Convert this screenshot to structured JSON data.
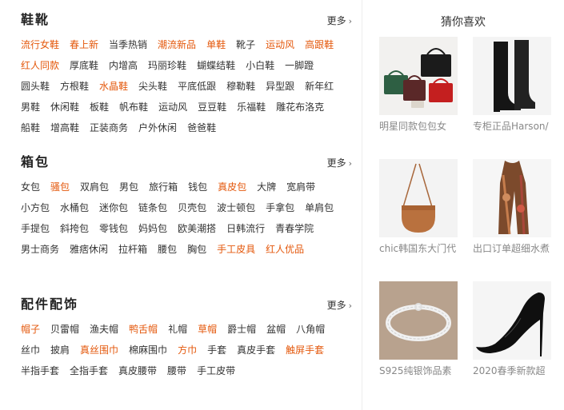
{
  "sections": [
    {
      "title": "鞋靴",
      "more": "更多",
      "tags": [
        {
          "t": "流行女鞋",
          "hot": true
        },
        {
          "t": "春上新",
          "hot": true
        },
        {
          "t": "当季热销",
          "hot": false
        },
        {
          "t": "潮流新品",
          "hot": true
        },
        {
          "t": "单鞋",
          "hot": true
        },
        {
          "t": "靴子",
          "hot": false
        },
        {
          "t": "运动风",
          "hot": true
        },
        {
          "t": "高跟鞋",
          "hot": true
        },
        {
          "t": "红人同款",
          "hot": true
        },
        {
          "t": "厚底鞋",
          "hot": false
        },
        {
          "t": "内增高",
          "hot": false
        },
        {
          "t": "玛丽珍鞋",
          "hot": false
        },
        {
          "t": "蝴蝶结鞋",
          "hot": false
        },
        {
          "t": "小白鞋",
          "hot": false
        },
        {
          "t": "一脚蹬",
          "hot": false
        },
        {
          "t": "圆头鞋",
          "hot": false
        },
        {
          "t": "方根鞋",
          "hot": false
        },
        {
          "t": "水晶鞋",
          "hot": true
        },
        {
          "t": "尖头鞋",
          "hot": false
        },
        {
          "t": "平底低跟",
          "hot": false
        },
        {
          "t": "穆勒鞋",
          "hot": false
        },
        {
          "t": "异型跟",
          "hot": false
        },
        {
          "t": "新年红",
          "hot": false
        },
        {
          "t": "男鞋",
          "hot": false
        },
        {
          "t": "休闲鞋",
          "hot": false
        },
        {
          "t": "板鞋",
          "hot": false
        },
        {
          "t": "帆布鞋",
          "hot": false
        },
        {
          "t": "运动风",
          "hot": false
        },
        {
          "t": "豆豆鞋",
          "hot": false
        },
        {
          "t": "乐福鞋",
          "hot": false
        },
        {
          "t": "雕花布洛克",
          "hot": false
        },
        {
          "t": "船鞋",
          "hot": false
        },
        {
          "t": "增高鞋",
          "hot": false
        },
        {
          "t": "正装商务",
          "hot": false
        },
        {
          "t": "户外休闲",
          "hot": false
        },
        {
          "t": "爸爸鞋",
          "hot": false
        }
      ]
    },
    {
      "title": "箱包",
      "more": "更多",
      "tags": [
        {
          "t": "女包",
          "hot": false
        },
        {
          "t": "骚包",
          "hot": true
        },
        {
          "t": "双肩包",
          "hot": false
        },
        {
          "t": "男包",
          "hot": false
        },
        {
          "t": "旅行箱",
          "hot": false
        },
        {
          "t": "钱包",
          "hot": false
        },
        {
          "t": "真皮包",
          "hot": true
        },
        {
          "t": "大牌",
          "hot": false
        },
        {
          "t": "宽肩带",
          "hot": false
        },
        {
          "t": "小方包",
          "hot": false
        },
        {
          "t": "水桶包",
          "hot": false
        },
        {
          "t": "迷你包",
          "hot": false
        },
        {
          "t": "链条包",
          "hot": false
        },
        {
          "t": "贝壳包",
          "hot": false
        },
        {
          "t": "波士顿包",
          "hot": false
        },
        {
          "t": "手拿包",
          "hot": false
        },
        {
          "t": "单肩包",
          "hot": false
        },
        {
          "t": "手提包",
          "hot": false
        },
        {
          "t": "斜挎包",
          "hot": false
        },
        {
          "t": "零钱包",
          "hot": false
        },
        {
          "t": "妈妈包",
          "hot": false
        },
        {
          "t": "欧美潮搭",
          "hot": false
        },
        {
          "t": "日韩流行",
          "hot": false
        },
        {
          "t": "青春学院",
          "hot": false
        },
        {
          "t": "男士商务",
          "hot": false
        },
        {
          "t": "雅痞休闲",
          "hot": false
        },
        {
          "t": "拉杆箱",
          "hot": false
        },
        {
          "t": "腰包",
          "hot": false
        },
        {
          "t": "胸包",
          "hot": false
        },
        {
          "t": "手工皮具",
          "hot": true
        },
        {
          "t": "红人优品",
          "hot": true
        }
      ]
    },
    {
      "title": "配件配饰",
      "more": "更多",
      "tags": [
        {
          "t": "帽子",
          "hot": true
        },
        {
          "t": "贝雷帽",
          "hot": false
        },
        {
          "t": "渔夫帽",
          "hot": false
        },
        {
          "t": "鸭舌帽",
          "hot": true
        },
        {
          "t": "礼帽",
          "hot": false
        },
        {
          "t": "草帽",
          "hot": true
        },
        {
          "t": "爵士帽",
          "hot": false
        },
        {
          "t": "盆帽",
          "hot": false
        },
        {
          "t": "八角帽",
          "hot": false
        },
        {
          "t": "丝巾",
          "hot": false
        },
        {
          "t": "披肩",
          "hot": false
        },
        {
          "t": "真丝围巾",
          "hot": true
        },
        {
          "t": "棉麻围巾",
          "hot": false
        },
        {
          "t": "方巾",
          "hot": true
        },
        {
          "t": "手套",
          "hot": false
        },
        {
          "t": "真皮手套",
          "hot": false
        },
        {
          "t": "触屏手套",
          "hot": true
        },
        {
          "t": "半指手套",
          "hot": false
        },
        {
          "t": "全指手套",
          "hot": false
        },
        {
          "t": "真皮腰带",
          "hot": false
        },
        {
          "t": "腰带",
          "hot": false
        },
        {
          "t": "手工皮带",
          "hot": false
        }
      ]
    }
  ],
  "recommend": {
    "title": "猜你喜欢",
    "items": [
      {
        "caption": "明星同款包包女",
        "image_icon": "handbags-image"
      },
      {
        "caption": "专柜正品Harson/",
        "image_icon": "knee-boots-image"
      },
      {
        "caption": "chic韩国东大门代",
        "image_icon": "saddle-bag-image"
      },
      {
        "caption": "出口订单超细水煮",
        "image_icon": "scarf-image"
      },
      {
        "caption": "S925纯银饰品素",
        "image_icon": "silver-bracelet-image"
      },
      {
        "caption": "2020春季新款超",
        "image_icon": "stiletto-heel-image"
      }
    ]
  },
  "colors": {
    "hot": "#e4580c",
    "normal": "#333333",
    "caption": "#888888"
  }
}
